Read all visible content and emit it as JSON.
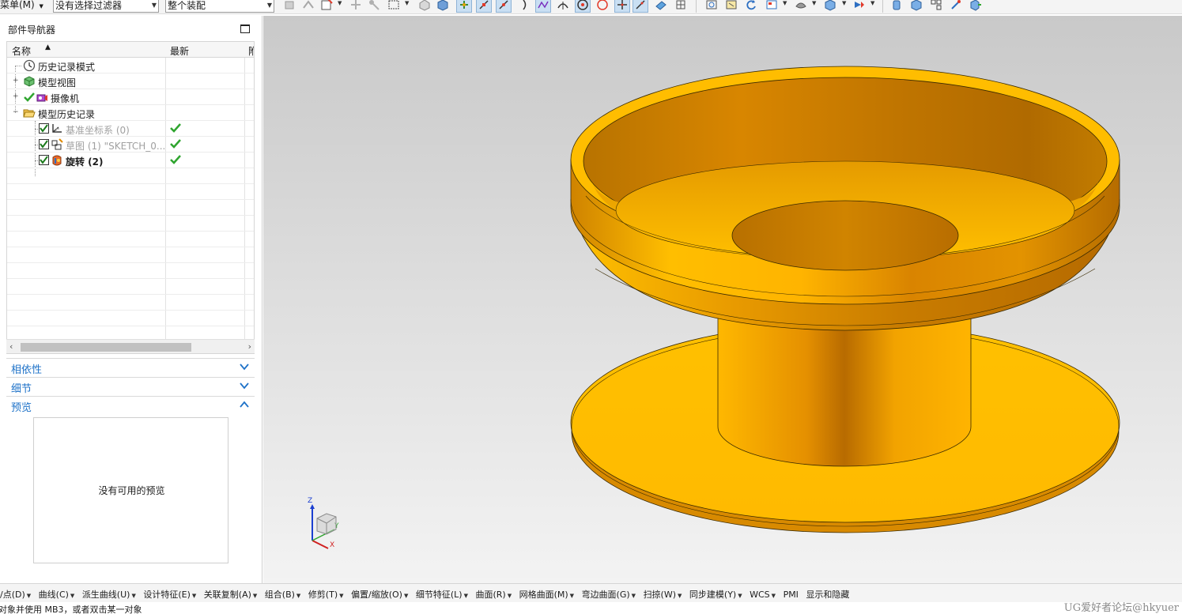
{
  "toolbar": {
    "menu_label": "菜单(M)",
    "selection_filter": "没有选择过滤器",
    "selection_scope": "整个装配"
  },
  "navigator": {
    "title": "部件导航器",
    "columns": {
      "name": "名称",
      "latest": "最新",
      "extra": "附"
    },
    "items": [
      {
        "label": "历史记录模式",
        "icon": "history-clock-icon",
        "expander": "",
        "latest": false
      },
      {
        "label": "模型视图",
        "icon": "model-views-icon",
        "expander": "+",
        "latest": false
      },
      {
        "label": "摄像机",
        "icon": "camera-icon",
        "expander": "+",
        "latest": false
      },
      {
        "label": "模型历史记录",
        "icon": "folder-open-icon",
        "expander": "−",
        "latest": false
      },
      {
        "label": "基准坐标系 (0)",
        "icon": "datum-csys-icon",
        "expander": "",
        "latest": true
      },
      {
        "label": "草图 (1) \"SKETCH_0...",
        "icon": "sketch-icon",
        "expander": "",
        "latest": true
      },
      {
        "label": "旋转 (2)",
        "icon": "revolve-icon",
        "expander": "",
        "latest": true
      }
    ]
  },
  "panels": {
    "dependencies": "相依性",
    "details": "细节",
    "preview": "预览",
    "no_preview": "没有可用的预览"
  },
  "viewport": {
    "triad_labels": {
      "x": "X",
      "y": "Y",
      "z": "Z"
    }
  },
  "menubar": {
    "items": [
      "/点(D)",
      "曲线(C)",
      "派生曲线(U)",
      "设计特征(E)",
      "关联复制(A)",
      "组合(B)",
      "修剪(T)",
      "偏置/缩放(O)",
      "细节特征(L)",
      "曲面(R)",
      "网格曲面(M)",
      "弯边曲面(G)",
      "扫掠(W)",
      "同步建模(Y)",
      "WCS",
      "PMI",
      "显示和隐藏"
    ]
  },
  "status": {
    "message": "对象并使用 MB3，或者双击某一对象",
    "watermark": "UG爱好者论坛@hkyuer"
  },
  "colors": {
    "model_orange": "#ffb300",
    "section_header_blue": "#1e72c8",
    "check_green": "#2fa52f"
  }
}
